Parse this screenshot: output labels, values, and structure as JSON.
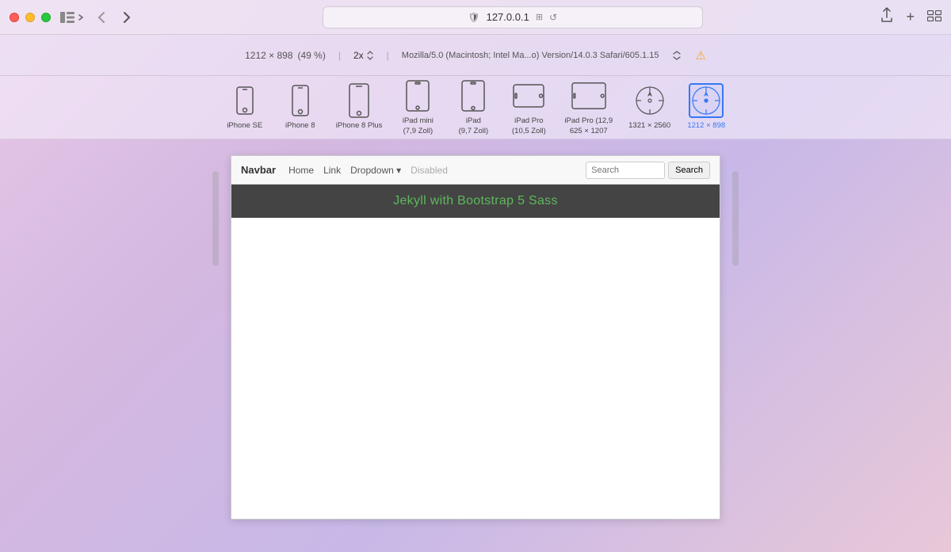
{
  "titlebar": {
    "url": "127.0.0.1",
    "share_icon": "⎦",
    "new_tab_icon": "+",
    "grid_icon": "⊞"
  },
  "responsive_header": {
    "dimensions": "1212 × 898",
    "percentage": "(49 %)",
    "scale": "2x",
    "ua_string": "Mozilla/5.0 (Macintosh; Intel Ma...o) Version/14.0.3 Safari/605.1.15",
    "warning": "⚠"
  },
  "devices": [
    {
      "id": "iphone-se",
      "label": "iPhone SE",
      "type": "phone-small",
      "selected": false
    },
    {
      "id": "iphone-8",
      "label": "iPhone 8",
      "type": "phone-medium",
      "selected": false
    },
    {
      "id": "iphone-8-plus",
      "label": "iPhone 8 Plus",
      "type": "phone-large",
      "selected": false
    },
    {
      "id": "ipad-mini",
      "label": "iPad mini\n(7,9 Zoll)",
      "type": "tablet-small",
      "selected": false
    },
    {
      "id": "ipad",
      "label": "iPad\n(9,7 Zoll)",
      "type": "tablet-medium",
      "selected": false
    },
    {
      "id": "ipad-pro-105",
      "label": "iPad Pro\n(10,5 Zoll)",
      "type": "tablet-landscape",
      "selected": false
    },
    {
      "id": "ipad-pro-129",
      "label": "iPad Pro (12,9\n625 × 1207",
      "type": "tablet-large",
      "selected": false
    },
    {
      "id": "res-1321",
      "label": "1321 × 2560",
      "type": "compass",
      "selected": false
    },
    {
      "id": "res-1212",
      "label": "1212 × 898",
      "type": "compass-selected",
      "selected": true
    }
  ],
  "preview": {
    "navbar_brand": "Navbar",
    "nav_home": "Home",
    "nav_link": "Link",
    "nav_dropdown": "Dropdown ▾",
    "nav_disabled": "Disabled",
    "search_placeholder": "Search",
    "search_button": "Search",
    "jumbotron_text": "Jekyll with Bootstrap 5 Sass"
  }
}
